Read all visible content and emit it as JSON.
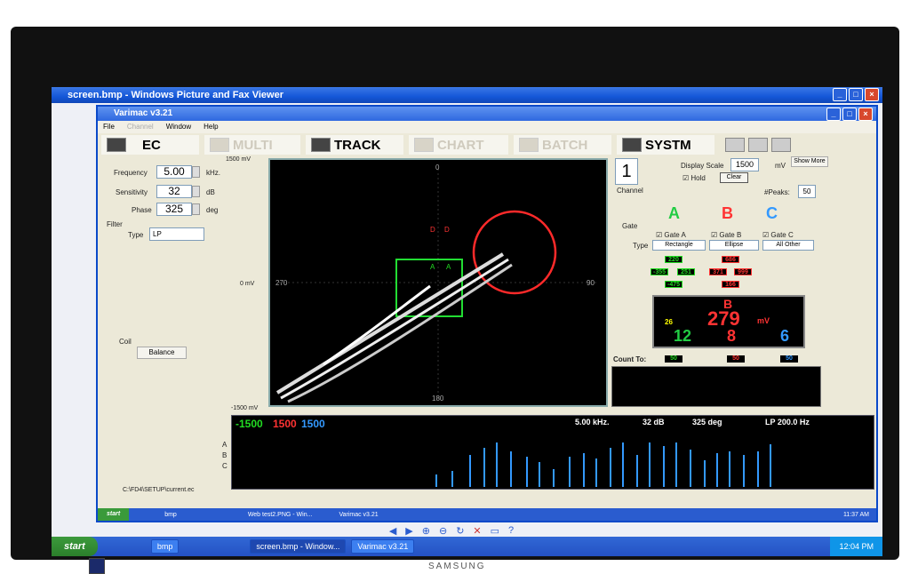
{
  "outer_window": {
    "title": "screen.bmp - Windows Picture and Fax Viewer"
  },
  "app": {
    "title": "Varimac v3.21"
  },
  "menu": [
    "File",
    "Channel",
    "Window",
    "Help"
  ],
  "modes": [
    "EC",
    "MULTI",
    "TRACK",
    "CHART",
    "BATCH",
    "SYSTM"
  ],
  "left": {
    "freq_label": "Frequency",
    "freq_val": "5.00",
    "freq_unit": "kHz.",
    "sens_label": "Sensitivity",
    "sens_val": "32",
    "sens_unit": "dB",
    "phase_label": "Phase",
    "phase_val": "325",
    "phase_unit": "deg",
    "filter_label": "Filter",
    "type_label": "Type",
    "type_val": "LP",
    "coil_label": "Coil",
    "balance": "Balance",
    "path": "C:\\FD4\\SETUP\\current.ec"
  },
  "scope": {
    "top_mv": "1500 mV",
    "zero_mv": "0 mV",
    "bot_mv": "-1500 mV",
    "t0": "0",
    "t90": "90",
    "t180": "180",
    "t270": "270",
    "box_a": "A",
    "box_d": "D"
  },
  "right": {
    "channel_val": "1",
    "channel_label": "Channel",
    "display_scale_label": "Display Scale",
    "display_scale_val": "1500",
    "display_scale_unit": "mV",
    "show_more": "Show More",
    "hold": "Hold",
    "clear": "Clear",
    "peaks_label": "#Peaks:",
    "peaks_val": "50",
    "gate_label": "Gate",
    "type_label": "Type",
    "gate_a": "Gate A",
    "gate_b": "Gate B",
    "gate_c": "Gate C",
    "type_a": "Rectangle",
    "type_b": "Ellipse",
    "type_c": "All Other",
    "A": "A",
    "B": "B",
    "C": "C",
    "a1": "220",
    "a2": "-355",
    "a3": "251",
    "a4": "-475",
    "b1": "686",
    "b2": "371",
    "b3": "999",
    "b4": "166",
    "big_gate": "B",
    "big_val": "279",
    "big_unit": "mV",
    "c_small": "26",
    "c1": "12",
    "c2": "8",
    "c3": "6",
    "count_to": "Count To:",
    "cnt1": "50",
    "cnt2": "50",
    "cnt3": "50"
  },
  "strip": {
    "s1": "-1500",
    "s2": "1500",
    "s3": "1500",
    "info1": "5.00 kHz.",
    "info2": "32 dB",
    "info3": "325 deg",
    "info4": "LP 200.0 Hz",
    "chA": "A",
    "chB": "B",
    "chC": "C"
  },
  "taskbar": {
    "start": "start",
    "t1": "bmp",
    "t2": "screen.bmp - Window...",
    "t3": "Varimac v3.21",
    "clock": "12:04 PM"
  },
  "inner_taskbar": {
    "start": "start",
    "t1": "bmp",
    "t2": "Web test2.PNG - Win...",
    "t3": "Varimac v3.21",
    "clock": "11:37 AM"
  },
  "bezel": {
    "brand": "SAMSUNG"
  },
  "colors": {
    "accent": "#1457d8",
    "gateA": "#22cc44",
    "gateB": "#ff3333",
    "gateC": "#3399ff"
  }
}
